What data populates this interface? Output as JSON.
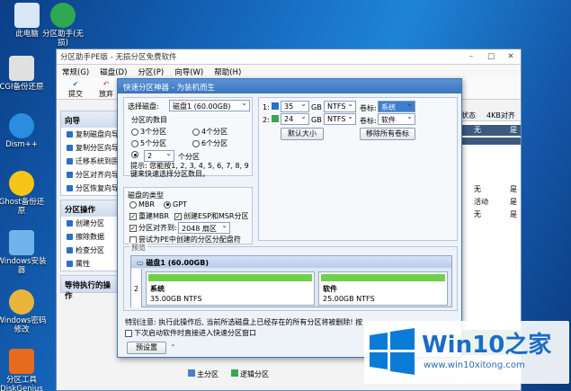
{
  "desktop_icons": [
    {
      "label": "此电脑",
      "icon": "computer-icon",
      "color": "#d8e6f5"
    },
    {
      "label": "分区助手(无损)",
      "icon": "partition-assistant-icon",
      "color": "#2fa84f"
    },
    {
      "label": "CGI备份还原",
      "icon": "cgi-icon",
      "color": "#e0e0e0"
    },
    {
      "label": "Dism++",
      "icon": "gear-icon",
      "color": "#2b8de0"
    },
    {
      "label": "Ghost备份还原",
      "icon": "ghost-icon",
      "color": "#f5c518"
    },
    {
      "label": "Windows安装器",
      "icon": "installer-icon",
      "color": "#6fb4ea"
    },
    {
      "label": "Windows密码修改",
      "icon": "key-icon",
      "color": "#e8b43a"
    },
    {
      "label": "分区工具DiskGenius",
      "icon": "diskgenius-icon",
      "color": "#e86a1e"
    }
  ],
  "app": {
    "title": "分区助手PE版 - 无损分区免费软件",
    "menu": [
      "常规(G)",
      "磁盘(D)",
      "分区(P)",
      "向导(W)",
      "帮助(H)"
    ],
    "toolbar": [
      "提交",
      "放弃"
    ],
    "wizard_title": "向导",
    "wizard_items": [
      "复制磁盘向导",
      "复制分区向导",
      "迁移系统到固态",
      "分区对齐向导",
      "分区恢复向导"
    ],
    "ops_title": "分区操作",
    "ops_items": [
      "创建分区",
      "擦除数据",
      "检查分区",
      "属性"
    ],
    "pending_title": "等待执行的操作",
    "col_status": "状态",
    "col_4k": "4KB对齐",
    "rows": [
      {
        "a": "无",
        "b": "是"
      },
      {
        "a": "无",
        "b": "是"
      },
      {
        "a": "活动",
        "b": "是"
      },
      {
        "a": "无",
        "b": "是"
      }
    ],
    "legend": {
      "primary": "主分区",
      "logical": "逻辑分区"
    }
  },
  "dialog": {
    "title": "快速分区神器 - 为装机而生",
    "select_disk_label": "选择磁盘:",
    "select_disk_value": "磁盘1 (60.00GB)",
    "count_label": "分区的数目",
    "radios": [
      "3个分区",
      "4个分区",
      "5个分区",
      "6个分区"
    ],
    "custom_count": "2",
    "custom_suffix": "个分区",
    "hint": "提示: 您能按1, 2, 3, 4, 5, 6, 7, 8, 9键来快速选择分区数目。",
    "disk_type_label": "磁盘的类型",
    "mbr": "MBR",
    "gpt": "GPT",
    "rebuild_mbr": "重建MBR",
    "create_esp": "创建ESP和MSR分区",
    "align_label": "分区对齐到:",
    "align_value": "2048 扇区",
    "pe_check": "尝试为PE中创建的分区分配盘符",
    "parts": [
      {
        "num": "1:",
        "size": "35",
        "unit": "GB",
        "fs": "NTFS",
        "vol_label": "卷标:",
        "vol": "系统"
      },
      {
        "num": "2:",
        "size": "24",
        "unit": "GB",
        "fs": "NTFS",
        "vol_label": "卷标:",
        "vol": "软件"
      }
    ],
    "default_size_btn": "默认大小",
    "remove_labels_btn": "移除所有卷标",
    "preview_label": "预览",
    "disk_name": "磁盘1 (60.00GB)",
    "blocks": [
      {
        "num": "2",
        "name": "系统",
        "size": "35.00GB NTFS"
      },
      {
        "name": "软件",
        "size": "25.00GB NTFS"
      }
    ],
    "warning": "特别注意: 执行此操作后, 当前所选磁盘上已经存在的所有分区将被删除! 按",
    "startup_check": "下次启动软件时直接进入快速分区窗口",
    "preset_btn": "预设置"
  },
  "watermark": {
    "title": "Win10之家",
    "url": "www.win10xitong.com"
  }
}
